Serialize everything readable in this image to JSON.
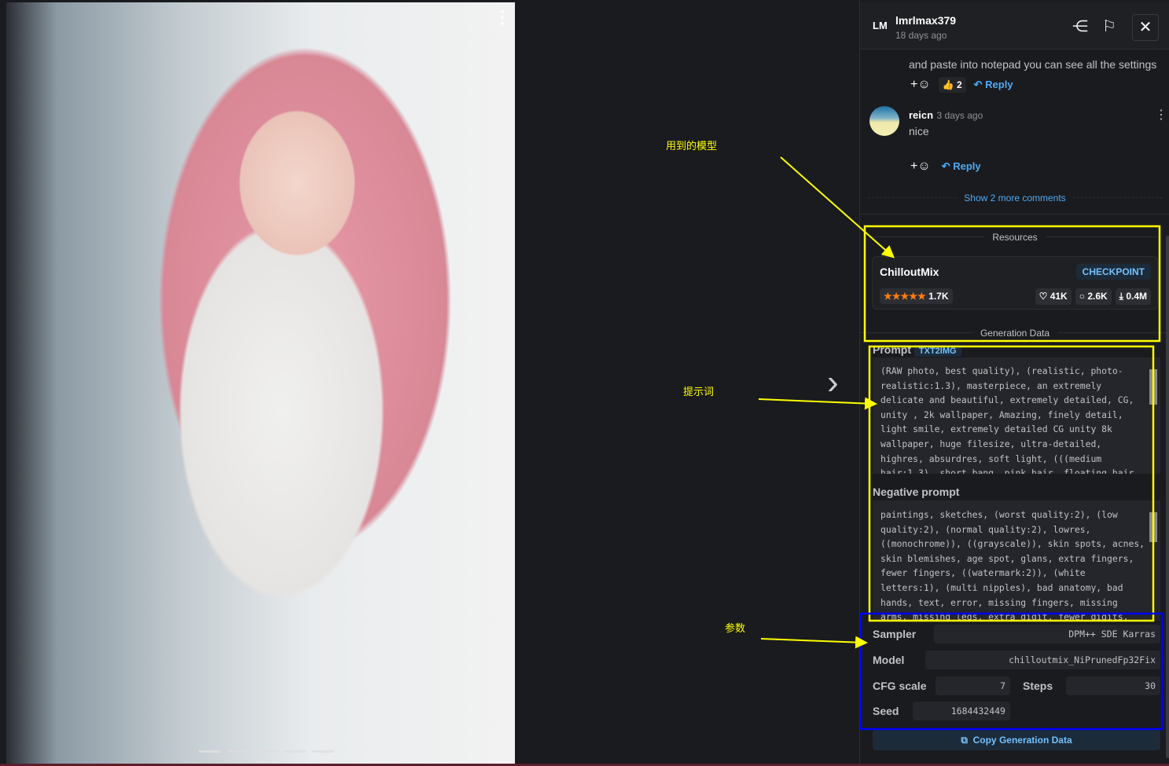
{
  "header": {
    "avatar_initials": "LM",
    "username": "lmrlmax379",
    "time": "18 days ago"
  },
  "comments": [
    {
      "text_partial": "and paste into notepad you can see all the settings",
      "reactions": {
        "thumbs_up": "2"
      },
      "reply_label": "Reply"
    },
    {
      "user": "reicn",
      "time": "3 days ago",
      "text": "nice",
      "reply_label": "Reply"
    }
  ],
  "show_more": "Show 2 more comments",
  "resources": {
    "title": "Resources",
    "name": "ChilloutMix",
    "type": "CHECKPOINT",
    "rating_count": "1.7K",
    "likes": "41K",
    "comments": "2.6K",
    "downloads": "0.4M",
    "stars": 5
  },
  "generation": {
    "title": "Generation Data",
    "prompt_label": "Prompt",
    "prompt_badge": "TXT2IMG",
    "prompt": "(RAW photo, best quality), (realistic, photo-realistic:1.3), masterpiece, an extremely delicate and beautiful, extremely detailed, CG, unity , 2k wallpaper, Amazing, finely detail, light smile, extremely detailed CG unity 8k wallpaper, huge filesize, ultra-detailed, highres, absurdres, soft light, (((medium hair:1.3), short bang, pink hair, floating hair novafrogstyle)), beautiful detailed",
    "negative_label": "Negative prompt",
    "negative": "paintings, sketches, (worst quality:2), (low quality:2), (normal quality:2), lowres, ((monochrome)), ((grayscale)), skin spots, acnes, skin blemishes, age spot, glans, extra fingers, fewer fingers, ((watermark:2)), (white letters:1), (multi nipples), bad anatomy, bad hands, text, error, missing fingers, missing arms, missing legs, extra digit, fewer digits, cropped, worst",
    "sampler_label": "Sampler",
    "sampler": "DPM++ SDE Karras",
    "model_label": "Model",
    "model": "chilloutmix_NiPrunedFp32Fix",
    "cfg_label": "CFG scale",
    "cfg": "7",
    "steps_label": "Steps",
    "steps": "30",
    "seed_label": "Seed",
    "seed": "1684432449",
    "copy_label": "Copy Generation Data"
  },
  "annotations": {
    "model": "用到的模型",
    "prompt": "提示词",
    "params": "参数"
  },
  "colors": {
    "annotation_yellow": "#ffff00",
    "annotation_blue": "#0000ff",
    "accent": "#4dabf7"
  }
}
